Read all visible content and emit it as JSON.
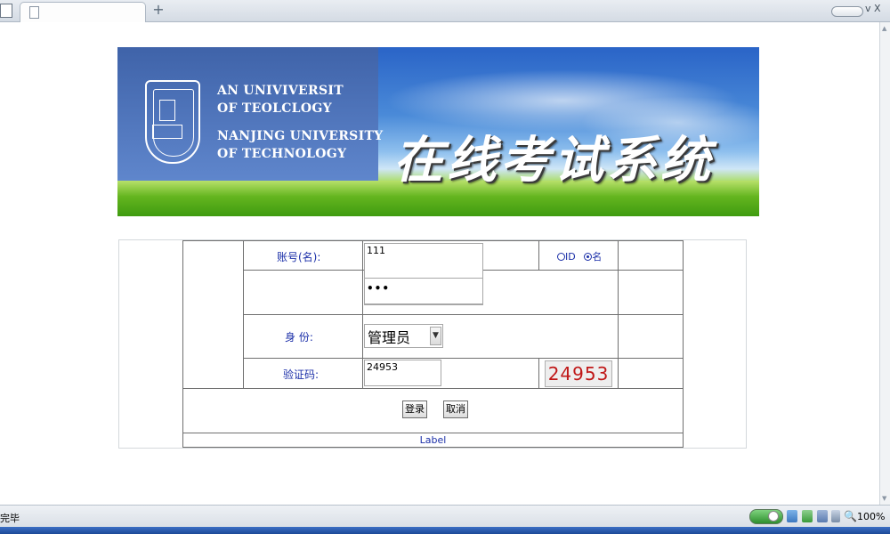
{
  "browser": {
    "tab_title": "",
    "new_tab_label": "+",
    "window_controls": "v X"
  },
  "banner": {
    "english_line1": "AN UNIVIVERSIT",
    "english_line2": "OF TEOLCLOGY",
    "english_line3": "NANJING UNIVERSITY",
    "english_line4": "OF TECHNOLOGY",
    "title": "在线考试系统"
  },
  "login": {
    "account_label": "账号(名):",
    "account_value": "111",
    "radio_id_label": "ID",
    "radio_name_label": "名",
    "password_value": "•••",
    "role_label": "身 份:",
    "role_selected": "管理员",
    "captcha_label": "验证码:",
    "captcha_value": "24953",
    "captcha_image_text": "24953",
    "login_button": "登录",
    "cancel_button": "取消",
    "footer_label": "Label"
  },
  "statusbar": {
    "status_text": "完毕",
    "zoom": "100%"
  },
  "colors": {
    "label_text": "#1b2fa8",
    "captcha_text": "#c01818",
    "table_border": "#707070"
  }
}
